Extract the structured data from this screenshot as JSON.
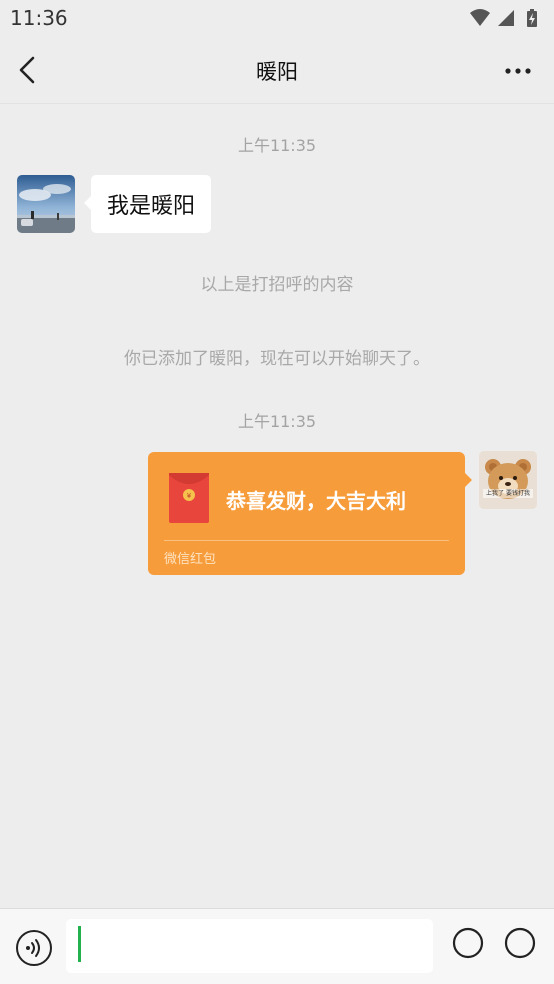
{
  "status_bar": {
    "time": "11:36"
  },
  "header": {
    "title": "暖阳"
  },
  "messages": {
    "timestamp_1": "上午11:35",
    "incoming_text": "我是暖阳",
    "greeting_note": "以上是打招呼的内容",
    "added_note": "你已添加了暖阳，现在可以开始聊天了。",
    "timestamp_2": "上午11:35",
    "red_packet": {
      "title": "恭喜发财，大吉大利",
      "footer": "微信红包",
      "color": "#f79c3a"
    },
    "self_avatar_text": "上我了 要钱打我"
  },
  "input": {
    "value": "",
    "accent": "#22b14c"
  },
  "icons": [
    "back-icon",
    "more-icon",
    "voice-icon",
    "emoji-icon",
    "plus-icon",
    "wifi-icon",
    "signal-icon",
    "battery-icon"
  ]
}
